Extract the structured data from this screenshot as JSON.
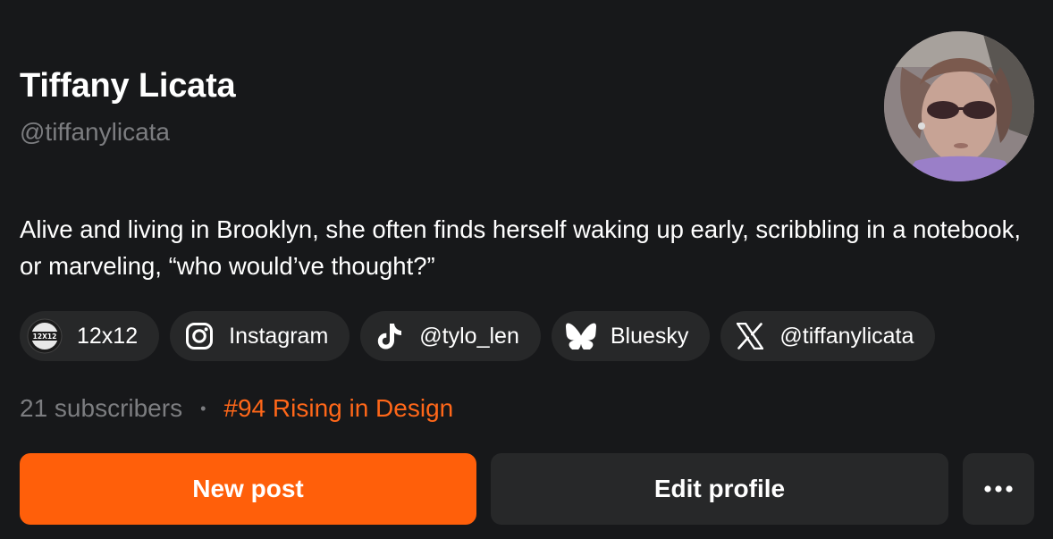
{
  "profile": {
    "name": "Tiffany Licata",
    "handle": "@tiffanylicata",
    "bio": "Alive and living in Brooklyn, she often finds herself waking up early, scribbling in a notebook, or marveling, “who would’ve thought?”"
  },
  "links": [
    {
      "label": "12x12",
      "icon": "12x12-logo-icon",
      "icon_text": "12X12"
    },
    {
      "label": "Instagram",
      "icon": "instagram-icon"
    },
    {
      "label": "@tylo_len",
      "icon": "tiktok-icon"
    },
    {
      "label": "Bluesky",
      "icon": "bluesky-butterfly-icon"
    },
    {
      "label": "@tiffanylicata",
      "icon": "x-logo-icon"
    }
  ],
  "stats": {
    "subscribers": "21 subscribers",
    "separator": "•",
    "rank": "#94 Rising in Design"
  },
  "actions": {
    "new_post": "New post",
    "edit_profile": "Edit profile",
    "more_icon": "more-dots-icon"
  },
  "colors": {
    "background": "#17181a",
    "accent": "#ff5f0a",
    "rank_text": "#ff6719",
    "pill_bg": "#272829",
    "muted_text": "#7c7d80"
  }
}
